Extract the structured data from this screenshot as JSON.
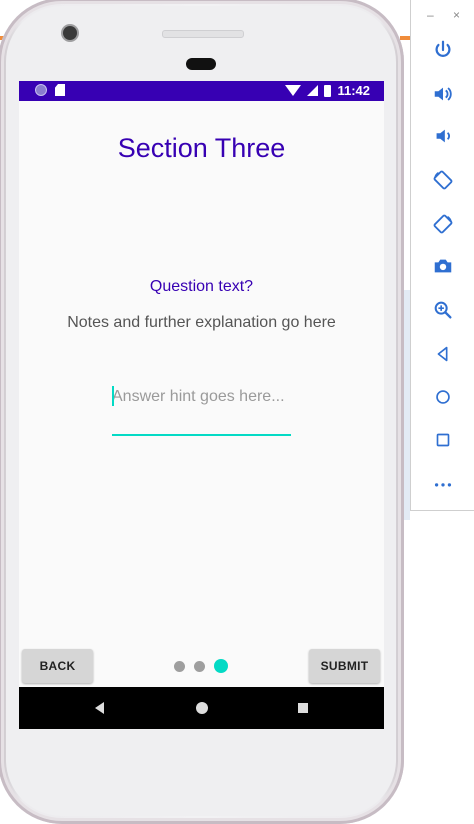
{
  "status_bar": {
    "time": "11:42"
  },
  "app": {
    "title": "Section Three",
    "question": "Question text?",
    "notes": "Notes and further explanation go here",
    "answer": {
      "value": "",
      "placeholder": "Answer hint goes here..."
    },
    "back_label": "BACK",
    "submit_label": "SUBMIT",
    "page_indicator": {
      "total": 3,
      "current": 3
    }
  },
  "colors": {
    "primary": "#3700b3",
    "accent": "#03dac5"
  },
  "emulator_toolbar": {
    "window_controls": [
      "–",
      "×"
    ],
    "buttons": [
      "power-icon",
      "volume-up-icon",
      "volume-down-icon",
      "rotate-left-icon",
      "rotate-right-icon",
      "camera-icon",
      "zoom-icon",
      "back-icon",
      "home-icon",
      "overview-icon",
      "more-icon"
    ]
  }
}
